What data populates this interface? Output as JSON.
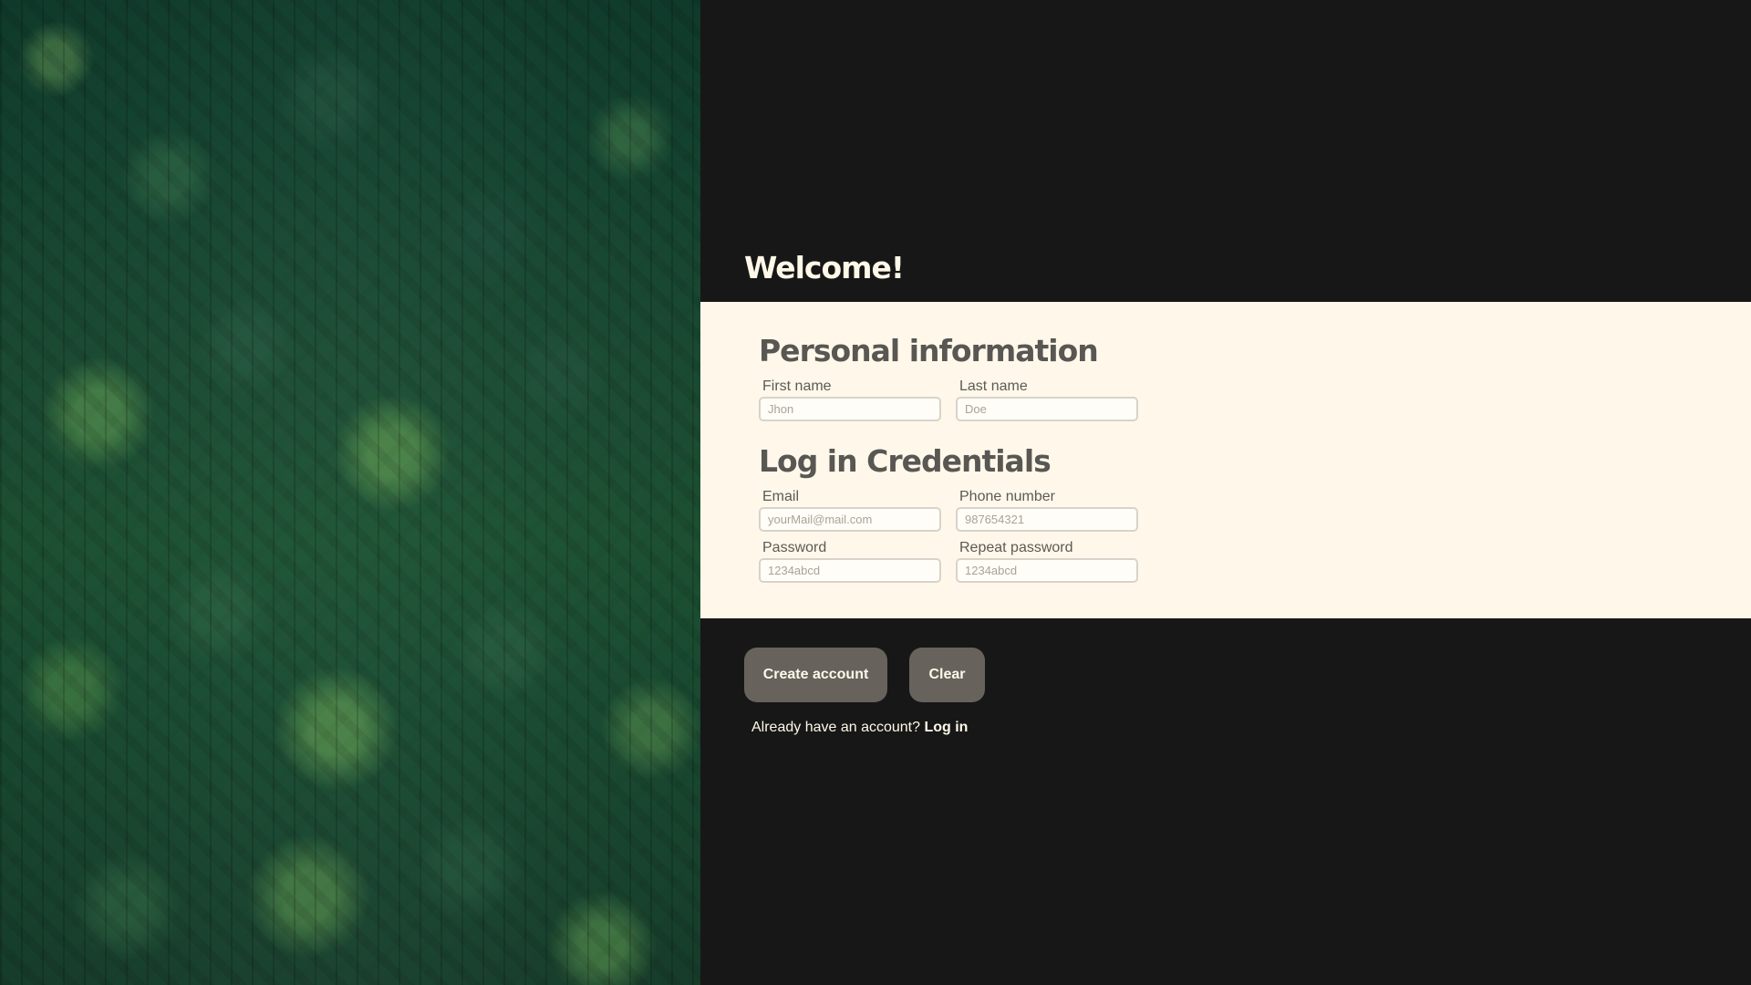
{
  "page": {
    "welcome_title": "Welcome!"
  },
  "form": {
    "personal_information_title": "Personal information",
    "credentials_title": "Log in Credentials",
    "fields": {
      "first_name": {
        "label": "First name",
        "placeholder": "Jhon",
        "value": ""
      },
      "last_name": {
        "label": "Last name",
        "placeholder": "Doe",
        "value": ""
      },
      "email": {
        "label": "Email",
        "placeholder": "yourMail@mail.com",
        "value": ""
      },
      "phone_number": {
        "label": "Phone number",
        "placeholder": "987654321",
        "value": ""
      },
      "password": {
        "label": "Password",
        "placeholder": "1234abcd",
        "value": ""
      },
      "repeat_password": {
        "label": "Repeat password",
        "placeholder": "1234abcd",
        "value": ""
      }
    }
  },
  "actions": {
    "create_account_label": "Create account",
    "clear_label": "Clear",
    "login_prompt": "Already have an account?",
    "login_link_label": "Log in"
  },
  "colors": {
    "page_background": "#171717",
    "form_background": "#fff8ea",
    "button_background": "#67625c",
    "light_text": "#fff8e8",
    "form_text": "#585753",
    "placeholder_text": "#a9a398"
  }
}
